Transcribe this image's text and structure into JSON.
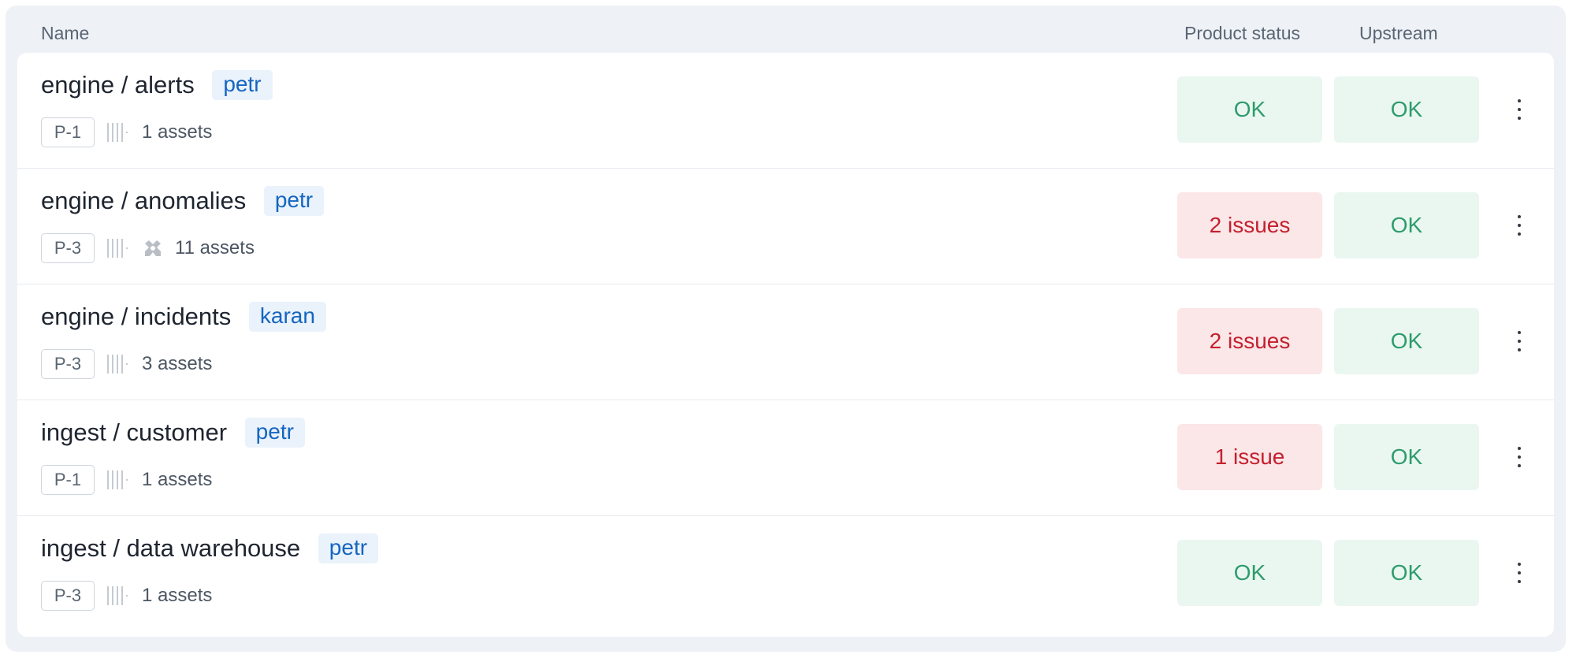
{
  "header": {
    "name": "Name",
    "product_status": "Product status",
    "upstream": "Upstream"
  },
  "rows": [
    {
      "title": "engine / alerts",
      "owner": "petr",
      "priority": "P-1",
      "assets": "1 assets",
      "has_puzzle": false,
      "product_status": "OK",
      "product_status_kind": "ok",
      "upstream": "OK",
      "upstream_kind": "ok"
    },
    {
      "title": "engine / anomalies",
      "owner": "petr",
      "priority": "P-3",
      "assets": "11 assets",
      "has_puzzle": true,
      "product_status": "2 issues",
      "product_status_kind": "bad",
      "upstream": "OK",
      "upstream_kind": "ok"
    },
    {
      "title": "engine / incidents",
      "owner": "karan",
      "priority": "P-3",
      "assets": "3 assets",
      "has_puzzle": false,
      "product_status": "2 issues",
      "product_status_kind": "bad",
      "upstream": "OK",
      "upstream_kind": "ok"
    },
    {
      "title": "ingest / customer",
      "owner": "petr",
      "priority": "P-1",
      "assets": "1 assets",
      "has_puzzle": false,
      "product_status": "1 issue",
      "product_status_kind": "bad",
      "upstream": "OK",
      "upstream_kind": "ok"
    },
    {
      "title": "ingest / data warehouse",
      "owner": "petr",
      "priority": "P-3",
      "assets": "1 assets",
      "has_puzzle": false,
      "product_status": "OK",
      "product_status_kind": "ok",
      "upstream": "OK",
      "upstream_kind": "ok"
    }
  ],
  "colors": {
    "ok_bg": "#eaf7f1",
    "ok_text": "#2e9c6c",
    "bad_bg": "#fbe6e8",
    "bad_text": "#c4202d",
    "owner_bg": "#eaf2fb",
    "owner_text": "#1565c0"
  },
  "icons": {
    "assets": "bars-icon",
    "component": "puzzle-icon",
    "menu": "kebab-menu-icon"
  }
}
